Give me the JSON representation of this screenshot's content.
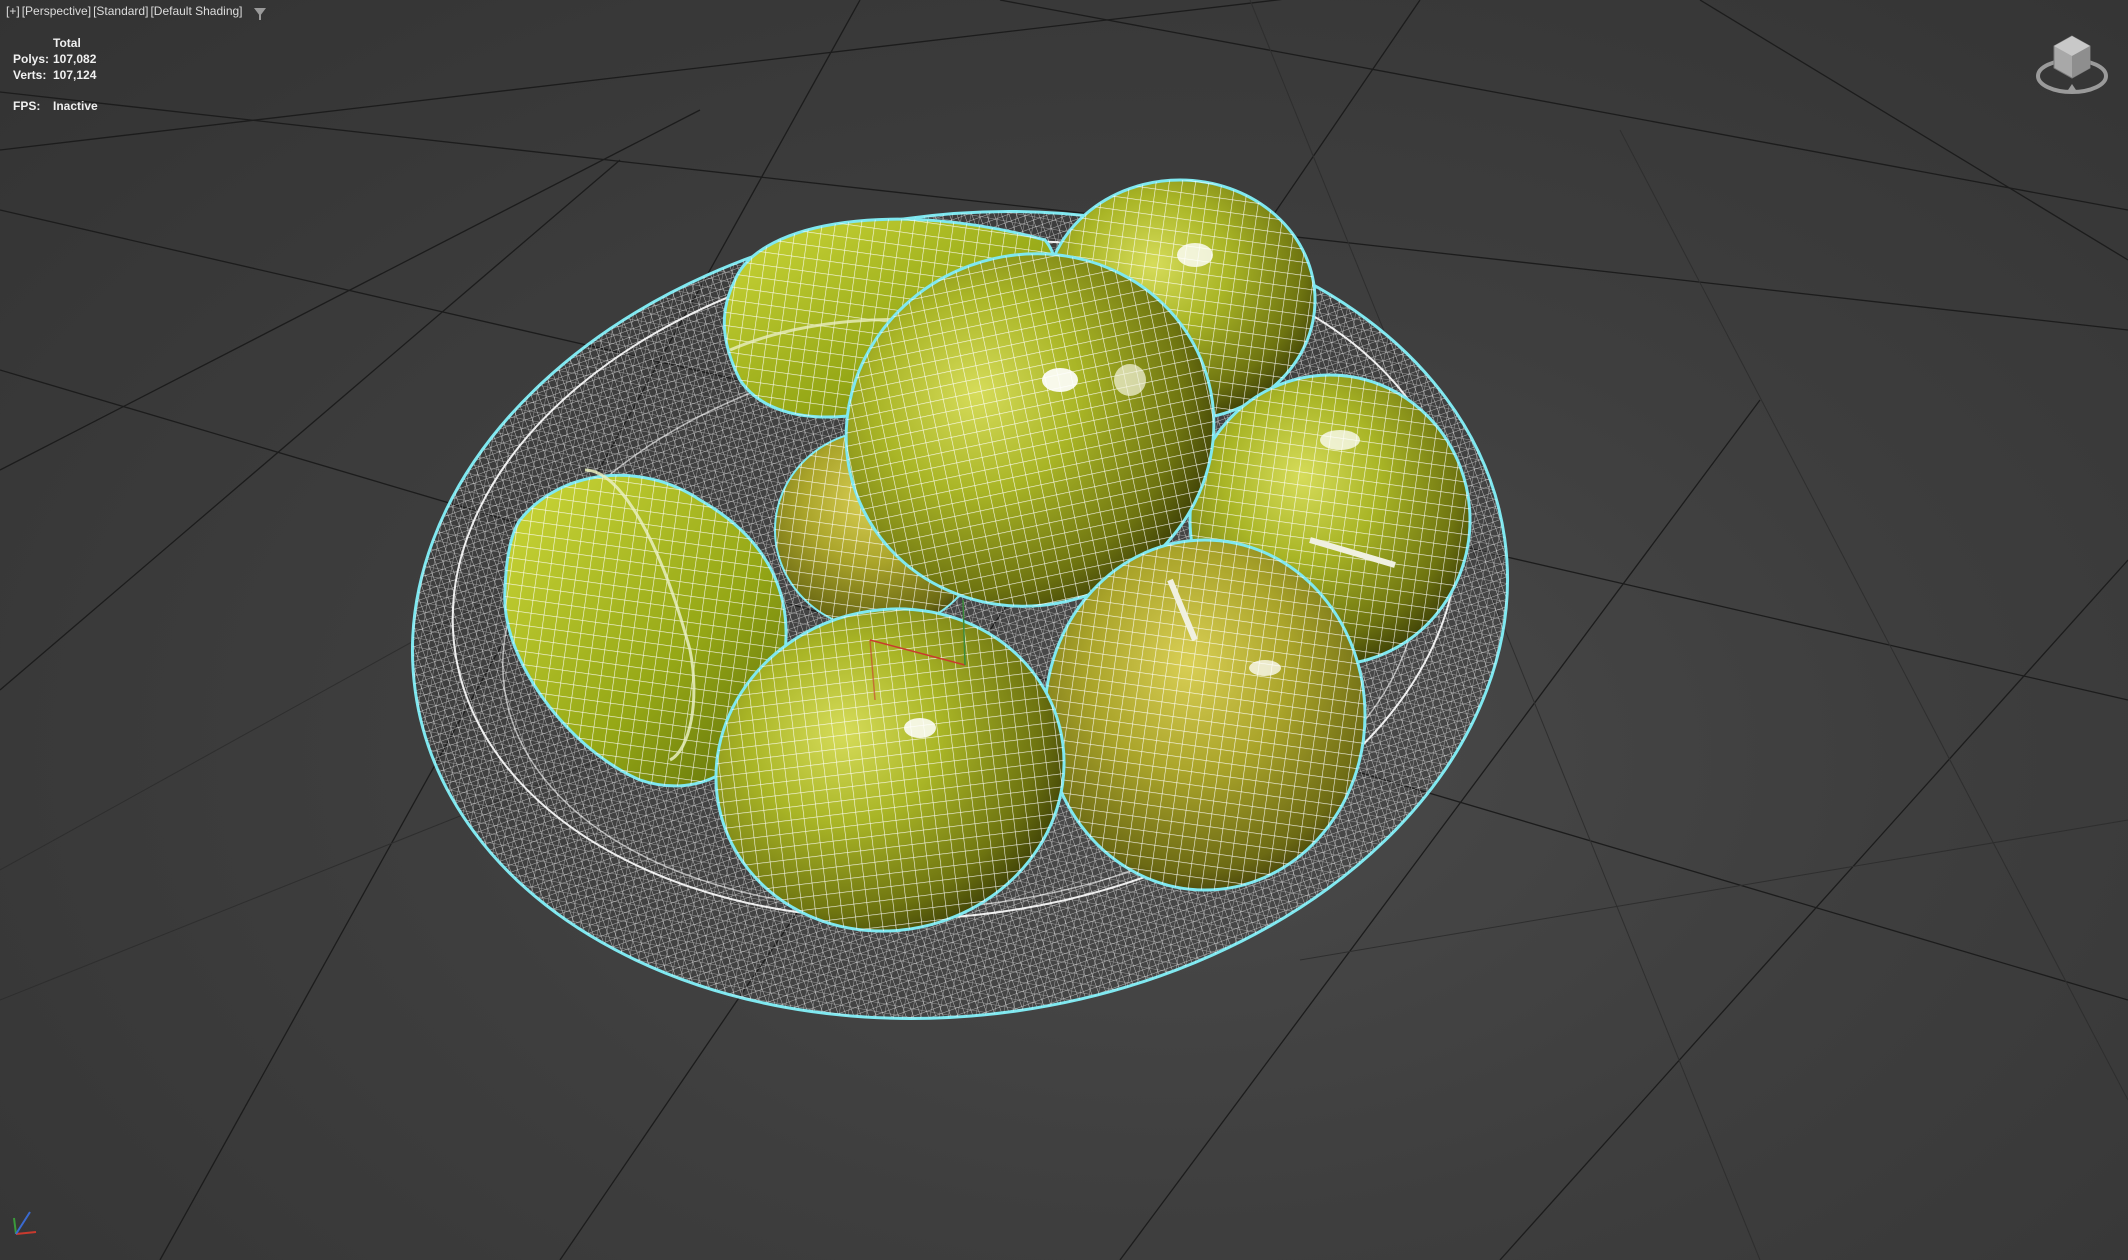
{
  "viewport": {
    "labels": [
      "[+]",
      "[Perspective]",
      "[Standard]",
      "[Default Shading]"
    ],
    "filter_icon": "funnel-icon"
  },
  "stats": {
    "header": "Total",
    "polys_label": "Polys:",
    "polys_value": "107,082",
    "verts_label": "Verts:",
    "verts_value": "107,124",
    "fps_label": "FPS:",
    "fps_value": "Inactive"
  },
  "scene": {
    "objects": [
      "bowl",
      "apple",
      "apple",
      "apple",
      "apple",
      "apple",
      "star-fruit",
      "star-fruit"
    ],
    "selection_color": "#7fe8f0",
    "wire_color": "#ffffff",
    "fruit_color": "#a8b828"
  },
  "gizmos": {
    "viewcube_icon": "viewcube-icon",
    "axis_icon": "axis-tripod-icon"
  }
}
